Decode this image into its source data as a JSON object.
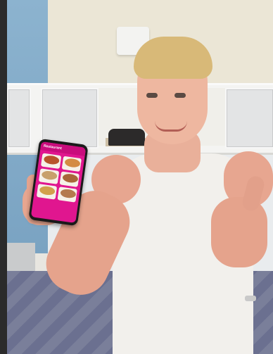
{
  "scene": {
    "description_icon": "photo-person-thumbs-up",
    "phone_screen": {
      "header": "Restaurant",
      "accent_color": "#e0168f",
      "tiles": [
        {
          "color": "#b8542b"
        },
        {
          "color": "#d48b43"
        },
        {
          "color": "#c8a06b"
        },
        {
          "color": "#a8663a"
        },
        {
          "color": "#d2a04c"
        },
        {
          "color": "#b47a4e"
        }
      ]
    }
  }
}
